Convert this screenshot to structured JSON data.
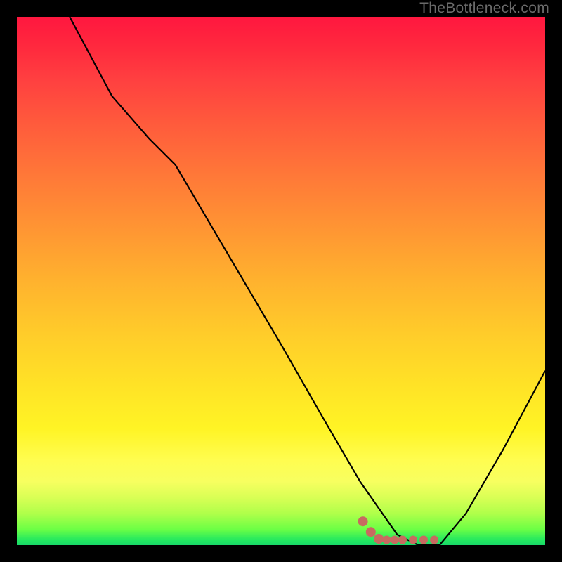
{
  "watermark": "TheBottleneck.com",
  "chart_data": {
    "type": "line",
    "title": "",
    "xlabel": "",
    "ylabel": "",
    "xlim": [
      0,
      100
    ],
    "ylim": [
      0,
      100
    ],
    "series": [
      {
        "name": "main-curve",
        "color": "#000000",
        "points": [
          {
            "x": 10,
            "y": 100
          },
          {
            "x": 18,
            "y": 85
          },
          {
            "x": 25,
            "y": 77
          },
          {
            "x": 30,
            "y": 72
          },
          {
            "x": 40,
            "y": 55
          },
          {
            "x": 50,
            "y": 38
          },
          {
            "x": 58,
            "y": 24
          },
          {
            "x": 65,
            "y": 12
          },
          {
            "x": 72,
            "y": 2
          },
          {
            "x": 76,
            "y": 0
          },
          {
            "x": 80,
            "y": 0
          },
          {
            "x": 85,
            "y": 6
          },
          {
            "x": 92,
            "y": 18
          },
          {
            "x": 100,
            "y": 33
          }
        ]
      },
      {
        "name": "dot-marker-trail",
        "color": "#c76a60",
        "points": [
          {
            "x": 65.5,
            "y": 4.5
          },
          {
            "x": 67,
            "y": 2.5
          },
          {
            "x": 68.5,
            "y": 1.2
          },
          {
            "x": 70,
            "y": 1.0
          },
          {
            "x": 71.5,
            "y": 1.0
          },
          {
            "x": 73,
            "y": 1.0
          },
          {
            "x": 75,
            "y": 1.0
          },
          {
            "x": 77,
            "y": 1.0
          },
          {
            "x": 79,
            "y": 1.0
          }
        ]
      }
    ]
  }
}
